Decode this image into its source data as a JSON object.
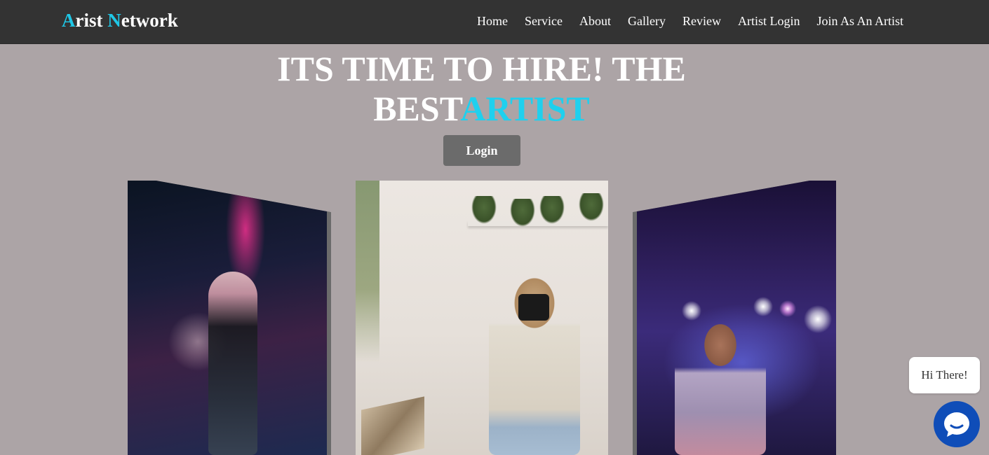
{
  "brand": {
    "first_initial": "A",
    "first_rest": "rist ",
    "second_initial": "N",
    "second_rest": "etwork",
    "accent_color": "#1fc7e6"
  },
  "nav": {
    "items": [
      {
        "label": "Home"
      },
      {
        "label": "Service"
      },
      {
        "label": "About"
      },
      {
        "label": "Gallery"
      },
      {
        "label": "Review"
      },
      {
        "label": "Artist Login"
      },
      {
        "label": "Join As An Artist"
      }
    ]
  },
  "hero": {
    "title_line1": "ITS TIME TO HIRE! THE",
    "title_line2_prefix": "BEST",
    "title_line2_accent": "ARTIST",
    "login_label": "Login"
  },
  "gallery": {
    "cards": [
      {
        "icon": "neon-street-model-photo"
      },
      {
        "icon": "photographer-with-camera-photo"
      },
      {
        "icon": "singer-on-stage-photo"
      }
    ]
  },
  "chat": {
    "greeting": "Hi There!",
    "button_color": "#0f4db8",
    "icon": "chat-bubble-icon"
  }
}
